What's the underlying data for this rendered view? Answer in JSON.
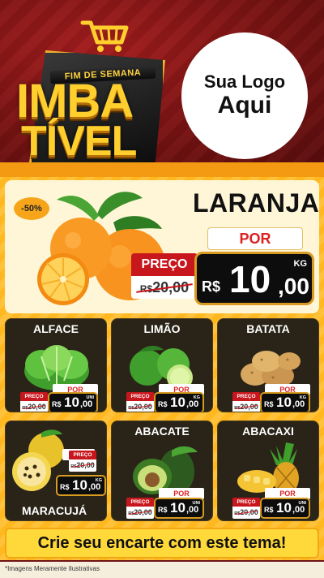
{
  "header": {
    "tagline": "FIM DE SEMANA",
    "headline_line1": "IMBA",
    "headline_line2": "TÍVEL",
    "logo_placeholder_line1": "Sua Logo",
    "logo_placeholder_line2": "Aqui"
  },
  "featured": {
    "discount": "-50%",
    "name": "LARANJA",
    "por_label": "POR",
    "preco_label": "PREÇO",
    "old_price_currency": "R$",
    "old_price": "20,00",
    "currency": "R$",
    "price_int": "10",
    "price_dec": ",00",
    "unit": "KG"
  },
  "products": [
    {
      "name": "ALFACE",
      "por_label": "POR",
      "preco_label": "PREÇO",
      "old_currency": "R$",
      "old_price": "20,00",
      "currency": "R$",
      "price_int": "10",
      "price_dec": ",00",
      "unit": "UNI"
    },
    {
      "name": "LIMÃO",
      "por_label": "POR",
      "preco_label": "PREÇO",
      "old_currency": "R$",
      "old_price": "20,00",
      "currency": "R$",
      "price_int": "10",
      "price_dec": ",00",
      "unit": "KG"
    },
    {
      "name": "BATATA",
      "por_label": "POR",
      "preco_label": "PREÇO",
      "old_currency": "R$",
      "old_price": "20,00",
      "currency": "R$",
      "price_int": "10",
      "price_dec": ",00",
      "unit": "KG"
    },
    {
      "name": "MARACUJÁ",
      "por_label": "POR",
      "preco_label": "PREÇO",
      "old_currency": "R$",
      "old_price": "20,00",
      "currency": "R$",
      "price_int": "10",
      "price_dec": ",00",
      "unit": "KG"
    },
    {
      "name": "ABACATE",
      "por_label": "POR",
      "preco_label": "PREÇO",
      "old_currency": "R$",
      "old_price": "20,00",
      "currency": "R$",
      "price_int": "10",
      "price_dec": ",00",
      "unit": "UNI"
    },
    {
      "name": "ABACAXI",
      "por_label": "POR",
      "preco_label": "PREÇO",
      "old_currency": "R$",
      "old_price": "20,00",
      "currency": "R$",
      "price_int": "10",
      "price_dec": ",00",
      "unit": "UNI"
    }
  ],
  "cta": "Crie seu encarte com este tema!",
  "footer_note": "*Imagens Meramente Ilustrativas",
  "colors": {
    "header_red": "#7a1313",
    "accent_yellow": "#ffc23a",
    "price_red": "#c8161d",
    "price_black": "#0d0d0d",
    "gold": "#d79b21"
  }
}
